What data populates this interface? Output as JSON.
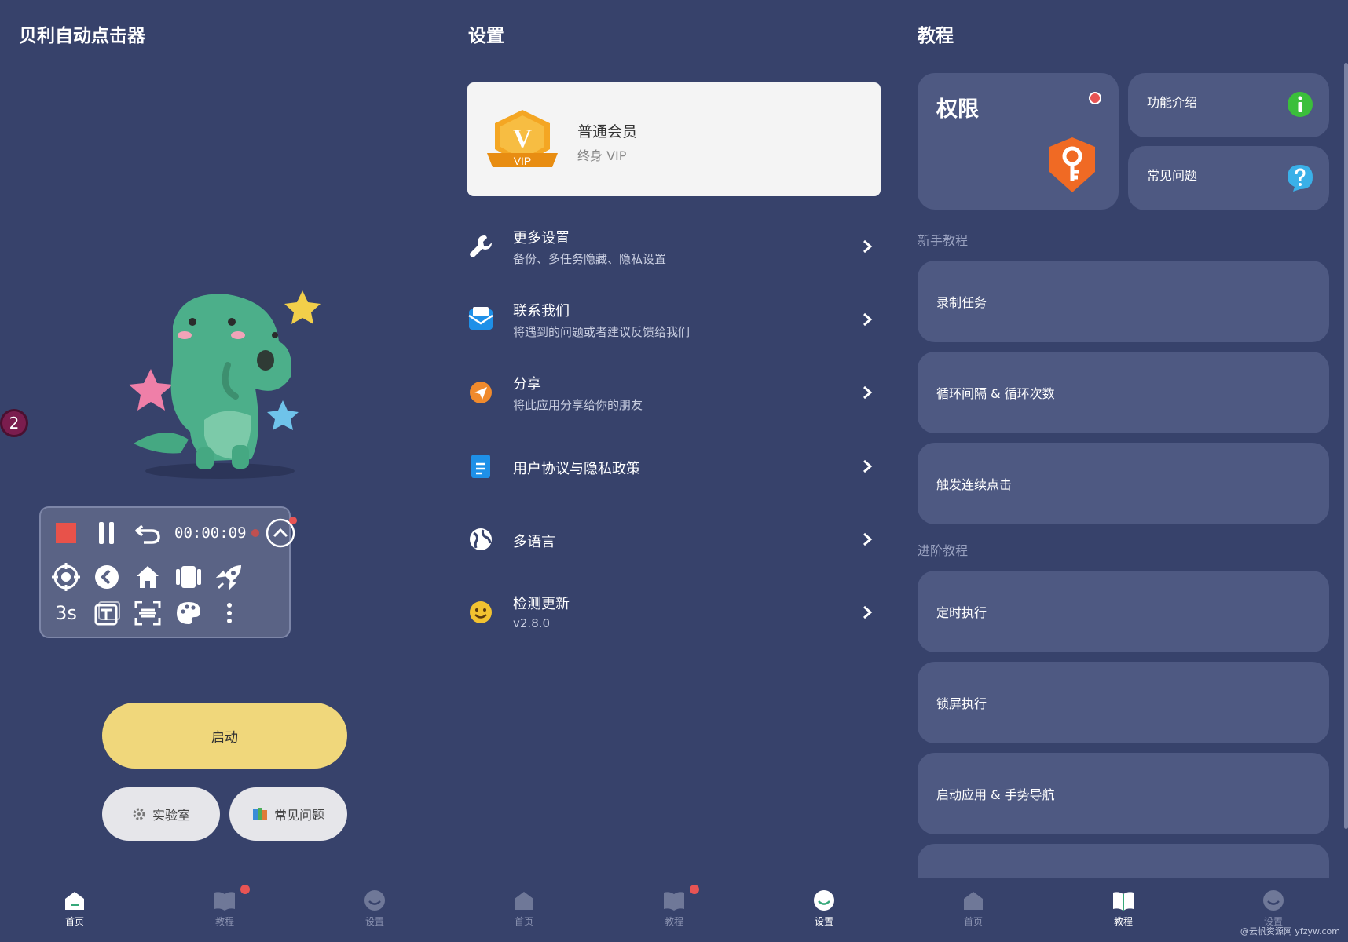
{
  "home": {
    "title": "贝利自动点击器",
    "side_badge": "2",
    "floatbar": {
      "timer": "00:00:09",
      "delay": "3s"
    },
    "start_button": "启动",
    "lab_button": "实验室",
    "faq_button": "常见问题"
  },
  "settings": {
    "title": "设置",
    "vip": {
      "title": "普通会员",
      "subtitle": "终身 VIP",
      "badge_letter": "V",
      "badge_text": "VIP"
    },
    "items": [
      {
        "title": "更多设置",
        "subtitle": "备份、多任务隐藏、隐私设置",
        "icon": "wrench-icon"
      },
      {
        "title": "联系我们",
        "subtitle": "将遇到的问题或者建议反馈给我们",
        "icon": "mail-icon"
      },
      {
        "title": "分享",
        "subtitle": "将此应用分享给你的朋友",
        "icon": "share-icon"
      },
      {
        "title": "用户协议与隐私政策",
        "subtitle": "",
        "icon": "document-icon"
      },
      {
        "title": "多语言",
        "subtitle": "",
        "icon": "globe-icon"
      },
      {
        "title": "检测更新",
        "subtitle": "v2.8.0",
        "icon": "smiley-icon"
      }
    ]
  },
  "tutorial": {
    "title": "教程",
    "permission_card": "权限",
    "feature_intro": "功能介绍",
    "faq": "常见问题",
    "beginner_label": "新手教程",
    "beginner_items": [
      "录制任务",
      "循环间隔 & 循环次数",
      "触发连续点击"
    ],
    "advanced_label": "进阶教程",
    "advanced_items": [
      "定时执行",
      "锁屏执行",
      "启动应用 & 手势导航"
    ]
  },
  "nav": [
    {
      "label": "首页",
      "active": true,
      "dot": false
    },
    {
      "label": "教程",
      "active": false,
      "dot": true
    },
    {
      "label": "设置",
      "active": false,
      "dot": false
    },
    {
      "label": "首页",
      "active": false,
      "dot": false
    },
    {
      "label": "教程",
      "active": false,
      "dot": true
    },
    {
      "label": "设置",
      "active": true,
      "dot": false
    },
    {
      "label": "首页",
      "active": false,
      "dot": false
    },
    {
      "label": "教程",
      "active": true,
      "dot": false
    },
    {
      "label": "设置",
      "active": false,
      "dot": false
    }
  ],
  "watermark": "@云帆资源网 yfzyw.com",
  "colors": {
    "background": "#37426b",
    "card": "#4e5982",
    "start_button": "#f0d77b",
    "notification_dot": "#e85454",
    "record_stop": "#e8524a"
  }
}
